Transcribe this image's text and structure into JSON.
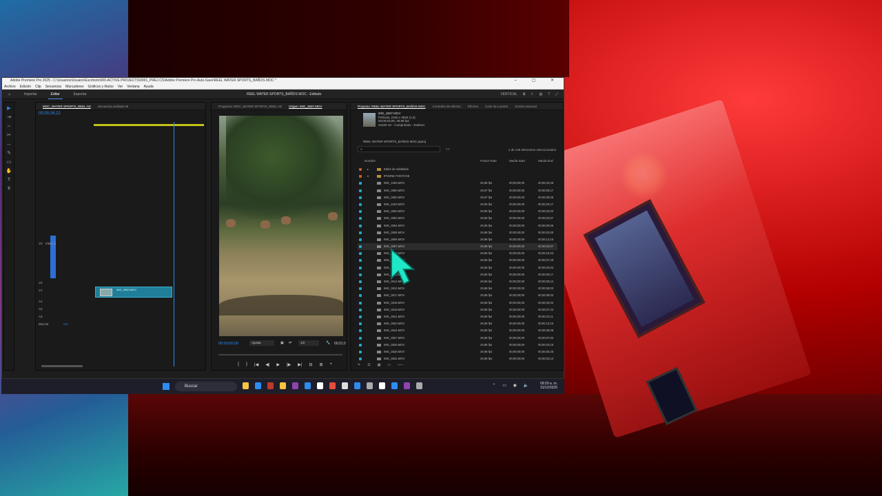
{
  "window": {
    "title": "Adobe Premiere Pro 2025 - C:\\Usuarios\\Usuario\\Escritorio\\000-ACTIVE PROJECTS\\0001_PREJ.CS\\Adobe Premiere Pro Auto-Save\\REEL WATER SPORTS_BAÑOS MOC *",
    "controls": "–  ▢  ✕"
  },
  "menu": [
    "Archivo",
    "Edición",
    "Clip",
    "Secuencia",
    "Marcadores",
    "Gráficos y títulos",
    "Ver",
    "Ventana",
    "Ayuda"
  ],
  "workspace_tabs": [
    "Importar",
    "Editar",
    "Exportar"
  ],
  "workspace_active": "Editar",
  "project_title": "REEL WATER SPORTS_BAÑOS MOC - Editado",
  "workspace_preset": "VERTICAL",
  "timeline": {
    "tab_main": "MOC_WATER SPORTS_REEL AD",
    "tab_second": "Secuencia anidada 06",
    "timecode": "00;00;26;22",
    "tracks": [
      {
        "label": "V3"
      },
      {
        "label": "V2"
      },
      {
        "label": "V1"
      },
      {
        "label": "A1"
      },
      {
        "label": "A2"
      },
      {
        "label": "A3"
      },
      {
        "label": "Mezcla"
      }
    ],
    "video_label": "Vídeo 2",
    "mix_value": "0,0",
    "clip_label": "IMG_3560.MOV"
  },
  "monitor": {
    "tab_program": "Programa: MOC_WATER SPORTS_REEL AD",
    "tab_source": "Origen: IMG_3507.MOV",
    "timecode": "00;00;00;00",
    "fit": "Ajustar",
    "resolution": "1/2",
    "duration": "00;01;0"
  },
  "project": {
    "tabs": [
      "Proyecto: REEL WATER SPORTS_BAÑOS MOC",
      "Controles de efectos",
      "Efectos",
      "Color de Lumetri",
      "Sonido esencial"
    ],
    "clip_info": {
      "name": "IMG_3507.MOV",
      "line1": "Película, 2160 x 3840 (1,0)",
      "line2": "00;00;03;08, 29,98 fps",
      "line3": "44100 Hz - Comprimido - Estéreo"
    },
    "file_name": "REEL WATER SPORTS_BAÑOS MOC.prproj",
    "search_placeholder": "",
    "count": "1 de 145 elementos seleccionados",
    "columns": {
      "name": "Nombre",
      "frame_rate": "Frame Rate",
      "media_start": "Media Start",
      "media_end": "Media End"
    },
    "folders": [
      "Editor de subtítulos",
      "IPHONE FOOTAGE"
    ],
    "rows": [
      {
        "name": "IMG_3493.MOV",
        "fps": "29,98 fps",
        "start": "00;00;00;00",
        "end": "00;00;23;28"
      },
      {
        "name": "IMG_3500.MOV",
        "fps": "29,97 fps",
        "start": "00;00;00;00",
        "end": "00;00;08;17"
      },
      {
        "name": "IMG_3500.MOV",
        "fps": "29,97 fps",
        "start": "00;00;00;00",
        "end": "00;00;06;25"
      },
      {
        "name": "IMG_3423.MOV",
        "fps": "29,98 fps",
        "start": "00;00;00;00",
        "end": "00;00;20;17"
      },
      {
        "name": "IMG_3503.MOV",
        "fps": "29,98 fps",
        "start": "00;00;00;00",
        "end": "00;00;03;20"
      },
      {
        "name": "IMG_3502.MOV",
        "fps": "29,98 fps",
        "start": "00;00;00;00",
        "end": "00;00;03;27"
      },
      {
        "name": "IMG_3504.MOV",
        "fps": "29,98 fps",
        "start": "00;00;00;00",
        "end": "00;00;09;06"
      },
      {
        "name": "IMG_3505.MOV",
        "fps": "29,98 fps",
        "start": "00;00;00;00",
        "end": "00;00;03;00"
      },
      {
        "name": "IMG_3506.MOV",
        "fps": "29,98 fps",
        "start": "00;00;00;00",
        "end": "00;00;13;16"
      },
      {
        "name": "IMG_3507.MOV",
        "fps": "29,98 fps",
        "start": "00;00;00;00",
        "end": "00;00;03;07",
        "selected": true
      },
      {
        "name": "IMG_3508.MOV",
        "fps": "29,98 fps",
        "start": "00;00;00;00",
        "end": "00;00;19;03"
      },
      {
        "name": "IMG_3509.MOV",
        "fps": "29,98 fps",
        "start": "00;00;00;00",
        "end": "00;00;07;28"
      },
      {
        "name": "IMG_3510.MOV",
        "fps": "29,98 fps",
        "start": "00;00;00;00",
        "end": "00;00;20;04"
      },
      {
        "name": "IMG_3511.MOV",
        "fps": "29,98 fps",
        "start": "00;00;00;00",
        "end": "00;00;09;17"
      },
      {
        "name": "IMG_3512.MOV",
        "fps": "29,98 fps",
        "start": "00;00;00;00",
        "end": "00;00;05;12"
      },
      {
        "name": "IMG_3513.MOV",
        "fps": "29,98 fps",
        "start": "00;00;00;00",
        "end": "00;00;06;03"
      },
      {
        "name": "IMG_3517.MOV",
        "fps": "29,98 fps",
        "start": "00;00;00;00",
        "end": "00;00;08;03"
      },
      {
        "name": "IMG_3518.MOV",
        "fps": "29,98 fps",
        "start": "00;00;00;00",
        "end": "00;00;20;02"
      },
      {
        "name": "IMG_3519.MOV",
        "fps": "29,98 fps",
        "start": "00;00;00;00",
        "end": "00;00;07;22"
      },
      {
        "name": "IMG_3521.MOV",
        "fps": "29,98 fps",
        "start": "00;00;00;00",
        "end": "00;00;24;11"
      },
      {
        "name": "IMG_3523.MOV",
        "fps": "29,98 fps",
        "start": "00;00;00;00",
        "end": "00;00;13;15"
      },
      {
        "name": "IMG_3524.MOV",
        "fps": "29,98 fps",
        "start": "00;00;00;00",
        "end": "00;00;06;08"
      },
      {
        "name": "IMG_3527.MOV",
        "fps": "29,98 fps",
        "start": "00;00;00;00",
        "end": "00;00;07;02"
      },
      {
        "name": "IMG_3529.MOV",
        "fps": "29,98 fps",
        "start": "00;00;00;00",
        "end": "00;00;03;15"
      },
      {
        "name": "IMG_3530.MOV",
        "fps": "29,98 fps",
        "start": "00;00;00;00",
        "end": "00;00;05;25"
      },
      {
        "name": "IMG_3531.MOV",
        "fps": "29,98 fps",
        "start": "00;00;00;00",
        "end": "00;00;03;12"
      }
    ]
  },
  "taskbar": {
    "search_label": "Buscar",
    "time": "09:29 a. m.",
    "date": "31/12/2025",
    "icon_colors": [
      "#f5c542",
      "#2d8cf0",
      "#c0392b",
      "#f5c542",
      "#8e44ad",
      "#2d8cf0",
      "#fff",
      "#e74c3c",
      "#ddd",
      "#2d8cf0",
      "#aaa",
      "#fff",
      "#2d8cf0",
      "#8e44ad",
      "#aaa"
    ]
  },
  "colors": {
    "accent": "#2d8cf0",
    "clip": "#1f7e99",
    "cursor": "#1ee8c8"
  }
}
